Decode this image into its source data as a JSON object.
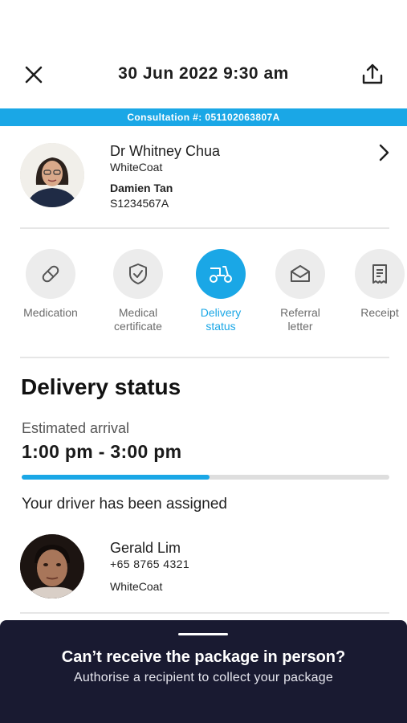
{
  "header": {
    "title": "30 Jun 2022  9:30 am"
  },
  "consultation": {
    "text": "Consultation #: 051102063807A"
  },
  "doctor": {
    "name": "Dr Whitney Chua",
    "org": "WhiteCoat"
  },
  "patient": {
    "name": "Damien Tan",
    "id": "S1234567A"
  },
  "tabs": [
    {
      "label": "Medication",
      "icon": "pill-icon",
      "active": false
    },
    {
      "label": "Medical certificate",
      "icon": "shield-check-icon",
      "active": false
    },
    {
      "label": "Delivery status",
      "icon": "scooter-icon",
      "active": true
    },
    {
      "label": "Referral letter",
      "icon": "envelope-icon",
      "active": false
    },
    {
      "label": "Receipt",
      "icon": "receipt-icon",
      "active": false
    }
  ],
  "delivery": {
    "title": "Delivery status",
    "eta_label": "Estimated arrival",
    "eta_value": "1:00 pm - 3:00 pm",
    "progress": 0.51,
    "driver_message": "Your driver has been assigned"
  },
  "driver": {
    "name": "Gerald Lim",
    "phone": "+65 8765 4321",
    "org": "WhiteCoat"
  },
  "sheet": {
    "title": "Can’t receive the package in person?",
    "subtitle": "Authorise a recipient to collect your package"
  },
  "colors": {
    "accent": "#1aa7e6",
    "sheet_bg": "#191a31",
    "inactive_tab": "#ececec"
  }
}
